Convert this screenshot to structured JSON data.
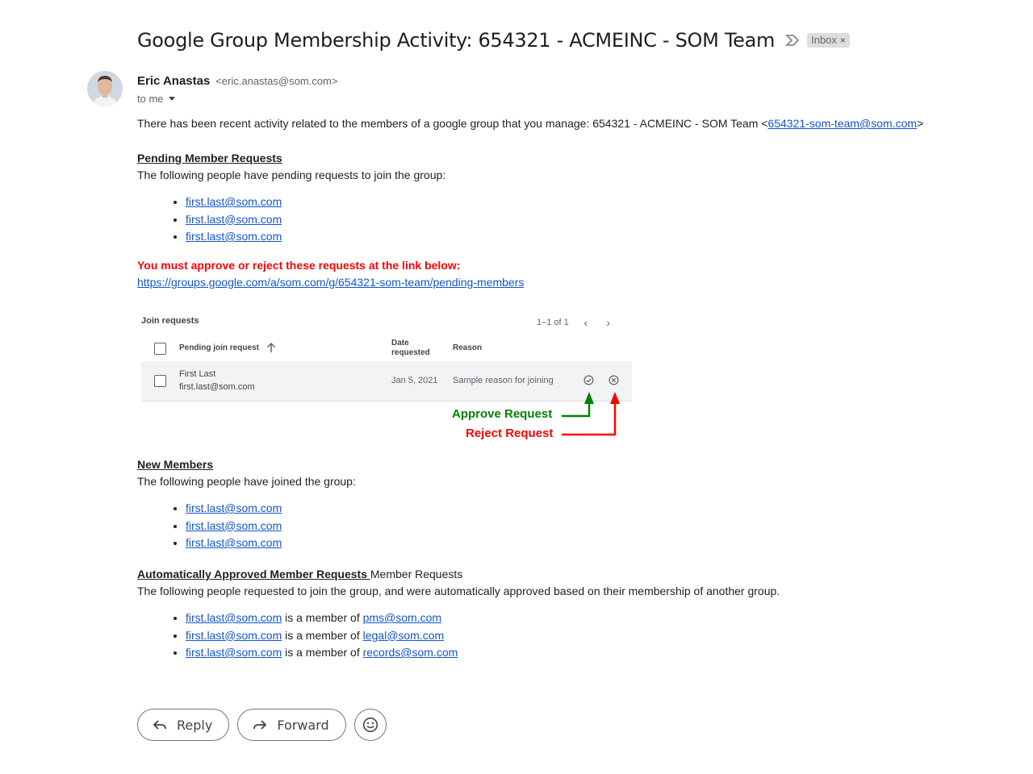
{
  "subject": "Google Group Membership Activity: 654321 - ACMEINC - SOM Team",
  "inbox_label": "Inbox",
  "inbox_remove": "×",
  "sender": {
    "name": "Eric Anastas",
    "email": "<eric.anastas@som.com>",
    "to": "to me"
  },
  "intro": {
    "text": "There has been recent activity related to the members of a google group that you manage: 654321 - ACMEINC - SOM Team <",
    "link": "654321-som-team@som.com",
    "suffix": ">"
  },
  "pending": {
    "title": "Pending Member Requests",
    "desc": "The following people have pending requests to join the group:",
    "emails": [
      "first.last@som.com",
      "first.last@som.com",
      "first.last@som.com"
    ],
    "warning": "You must approve or reject these requests at the link below:",
    "link": "https://groups.google.com/a/som.com/g/654321-som-team/pending-members"
  },
  "panel": {
    "title": "Join requests",
    "pager": "1–1 of 1",
    "col_request": "Pending join request",
    "col_date_1": "Date",
    "col_date_2": "requested",
    "col_reason": "Reason",
    "row": {
      "name": "First Last",
      "email": "first.last@som.com",
      "date": "Jan 5, 2021",
      "reason": "Sample reason for joining"
    }
  },
  "annotations": {
    "approve": "Approve Request",
    "reject": "Reject Request",
    "approve_color": "#008000",
    "reject_color": "#ff0000"
  },
  "new_members": {
    "title": "New Members",
    "desc": "The following people have joined the group:",
    "emails": [
      "first.last@som.com",
      "first.last@som.com",
      "first.last@som.com"
    ]
  },
  "auto": {
    "title": "Automatically Approved Member Requests ",
    "title_suffix": "Member Requests",
    "desc": "The following people requested to join the group, and were automatically approved based on their membership of another group.",
    "connector": " is a member of ",
    "items": [
      {
        "email": "first.last@som.com",
        "group": "pms@som.com"
      },
      {
        "email": "first.last@som.com",
        "group": "legal@som.com"
      },
      {
        "email": "first.last@som.com",
        "group": "records@som.com"
      }
    ]
  },
  "actions": {
    "reply": "Reply",
    "forward": "Forward"
  },
  "icons": [
    "importance-marker-icon",
    "avatar",
    "chevron-left-icon",
    "chevron-right-icon",
    "sort-up-icon",
    "check-circle-icon",
    "x-circle-icon",
    "reply-icon",
    "forward-icon",
    "emoji-icon"
  ]
}
